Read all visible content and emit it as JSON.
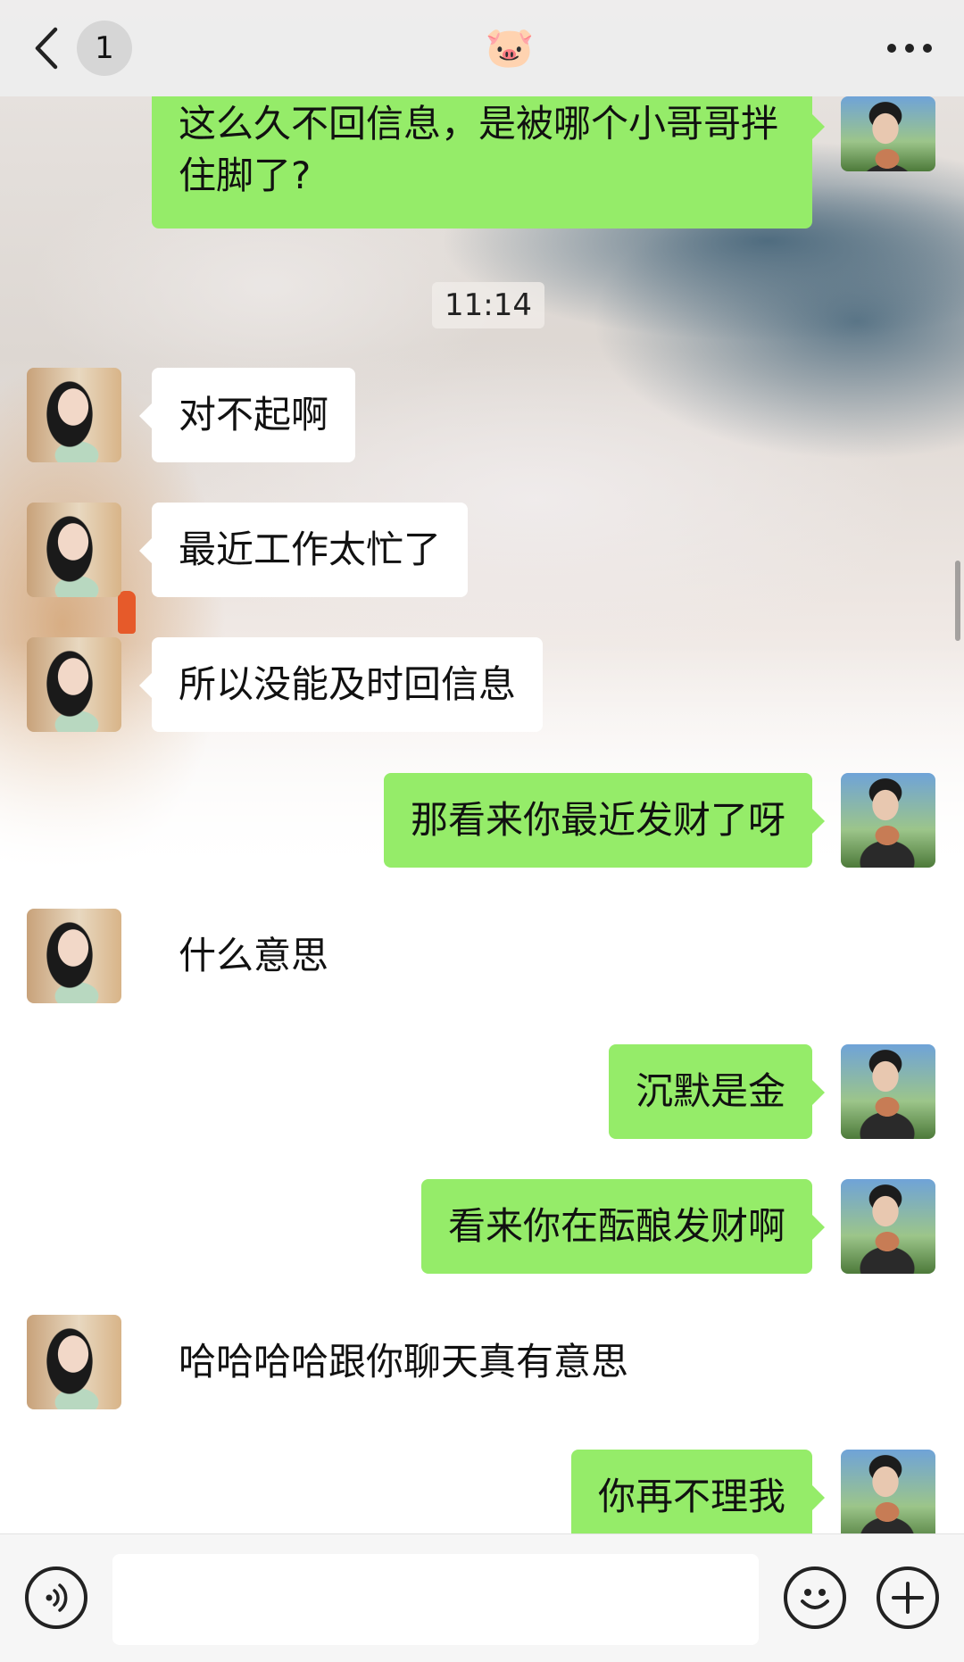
{
  "header": {
    "unread_count": "1",
    "title_icon": "🐷",
    "back_icon": "chevron-left-icon",
    "more_icon": "more-dots-icon"
  },
  "messages": [
    {
      "side": "right",
      "style": "green",
      "text": "这么久不回信息，是被哪个小哥哥拌住脚了?"
    },
    {
      "timestamp": "11:14"
    },
    {
      "side": "left",
      "style": "white",
      "text": "对不起啊"
    },
    {
      "side": "left",
      "style": "white",
      "text": "最近工作太忙了"
    },
    {
      "side": "left",
      "style": "white",
      "text": "所以没能及时回信息"
    },
    {
      "side": "right",
      "style": "green",
      "text": "那看来你最近发财了呀"
    },
    {
      "side": "left",
      "style": "plain",
      "text": "什么意思"
    },
    {
      "side": "right",
      "style": "green",
      "text": "沉默是金"
    },
    {
      "side": "right",
      "style": "green",
      "text": "看来你在酝酿发财啊"
    },
    {
      "side": "left",
      "style": "plain",
      "text": "哈哈哈哈跟你聊天真有意思"
    },
    {
      "side": "right",
      "style": "green",
      "text": "你再不理我"
    }
  ],
  "input_bar": {
    "voice_icon": "voice-icon",
    "emoji_icon": "emoji-icon",
    "plus_icon": "plus-icon",
    "text_value": ""
  },
  "colors": {
    "sent_bubble": "#95ec69",
    "received_bubble": "#ffffff",
    "header_bg": "#ededed"
  }
}
